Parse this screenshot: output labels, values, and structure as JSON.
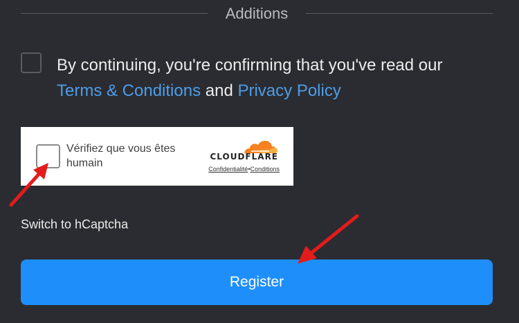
{
  "section": {
    "title": "Additions"
  },
  "consent": {
    "text_before": "By continuing, you're confirming that you've read our",
    "terms_link": "Terms & Conditions",
    "joiner": "and",
    "privacy_link": "Privacy Policy",
    "checked": false
  },
  "turnstile": {
    "label": "Vérifiez que vous êtes humain",
    "brand": "CLOUDFLARE",
    "privacy_link": "Confidentialité",
    "separator": "•",
    "terms_link": "Conditions",
    "checked": false,
    "logo_icon": "cloudflare-cloud-icon"
  },
  "switch_captcha": {
    "label": "Switch to hCaptcha"
  },
  "register": {
    "label": "Register"
  },
  "annotations": {
    "arrow_color": "#e31b1b",
    "arrows": [
      "red-arrow-to-verification-checkbox",
      "red-arrow-to-register-button"
    ]
  },
  "colors": {
    "background": "#2b2c31",
    "link": "#4d9de8",
    "primary_button": "#1e8ffa"
  }
}
